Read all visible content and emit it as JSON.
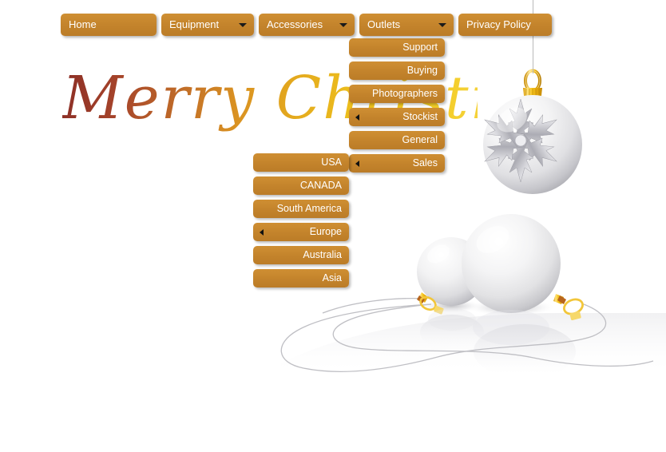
{
  "page": {
    "headline": "Merry Christmas",
    "background_color": "#ffffff",
    "accent_color": "#c4842c",
    "headline_gradient_start": "#8b2e26",
    "headline_gradient_end": "#f2ca1f"
  },
  "topmenu": {
    "items": [
      {
        "label": "Home",
        "has_caret": false,
        "width_class": "w-home",
        "name": "nav-home"
      },
      {
        "label": "Equipment",
        "has_caret": true,
        "width_class": "w-equip",
        "name": "nav-equipment"
      },
      {
        "label": "Accessories",
        "has_caret": true,
        "width_class": "w-access",
        "name": "nav-accessories"
      },
      {
        "label": "Outlets",
        "has_caret": true,
        "width_class": "w-outlet",
        "name": "nav-outlets"
      },
      {
        "label": "Privacy Policy",
        "has_caret": false,
        "width_class": "w-priv",
        "name": "nav-privacy-policy"
      }
    ]
  },
  "dropdown_outlets": {
    "parent": "Outlets",
    "items": [
      {
        "label": "Support",
        "has_submenu": false
      },
      {
        "label": "Buying",
        "has_submenu": false
      },
      {
        "label": "Photographers",
        "has_submenu": false
      },
      {
        "label": "Stockist",
        "has_submenu": true
      },
      {
        "label": "General",
        "has_submenu": false
      },
      {
        "label": "Sales",
        "has_submenu": true
      }
    ]
  },
  "dropdown_stockist": {
    "parent": "Stockist",
    "items": [
      {
        "label": "USA",
        "has_submenu": false
      },
      {
        "label": "CANADA",
        "has_submenu": false
      },
      {
        "label": "South America",
        "has_submenu": false
      },
      {
        "label": "Europe",
        "has_submenu": true
      },
      {
        "label": "Australia",
        "has_submenu": false
      },
      {
        "label": "Asia",
        "has_submenu": false
      }
    ]
  },
  "artwork": {
    "hanging_ornament": "christmas-ball-snowflake",
    "front_ornaments": [
      "christmas-ball-large",
      "christmas-ball-small"
    ],
    "ornament_color": "#f2f2f2",
    "cap_color": "#efb810",
    "thread_color": "#b9b9b9"
  }
}
